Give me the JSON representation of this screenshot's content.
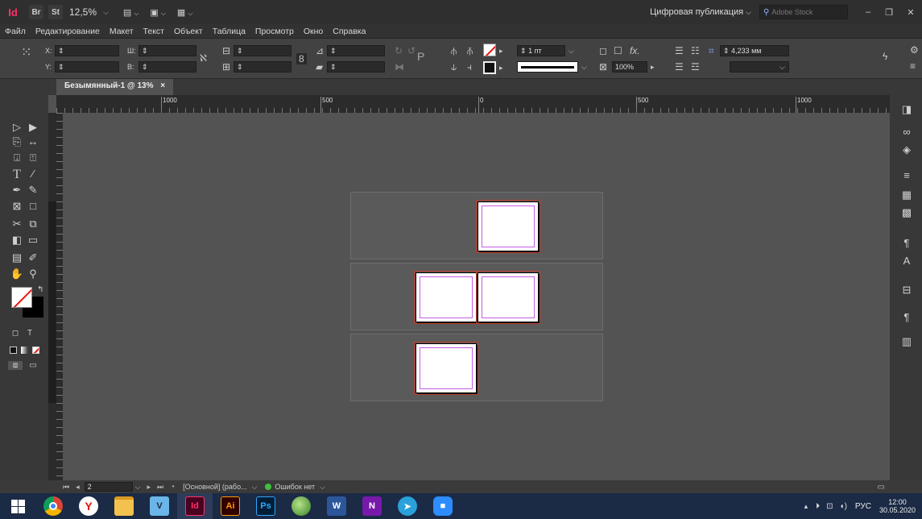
{
  "app": {
    "logo": "Id",
    "bridge": "Br",
    "stock": "St",
    "zoom": "12,5%",
    "workspace": "Цифровая публикация",
    "search_placeholder": "Adobe Stock",
    "minimize": "–",
    "restore": "❐",
    "close": "✕"
  },
  "menu": [
    "Файл",
    "Редактирование",
    "Макет",
    "Текст",
    "Объект",
    "Таблица",
    "Просмотр",
    "Окно",
    "Справка"
  ],
  "control": {
    "x_label": "X:",
    "y_label": "Y:",
    "w_label": "Ш:",
    "h_label": "В:",
    "stroke_weight": "1 пт",
    "opacity": "100%",
    "gap": "4,233 мм"
  },
  "document": {
    "tab_title": "Безымянный-1 @ 13%",
    "tab_close": "×"
  },
  "ruler": {
    "labels": [
      {
        "text": "1000"
      },
      {
        "text": "500"
      },
      {
        "text": "0"
      },
      {
        "text": "500"
      },
      {
        "text": "1000"
      }
    ],
    "v_labels": [
      "0",
      "0",
      "0"
    ]
  },
  "status": {
    "page_field": "2",
    "master": "[Основной] (рабо...",
    "preflight": "Ошибок нет"
  },
  "taskbar": {
    "lang": "РУС",
    "time": "12:00",
    "date": "30.05.2020",
    "apps": [
      {
        "name": "windows",
        "label": "",
        "color": "#1b2a45"
      },
      {
        "name": "chrome",
        "label": "",
        "color": "#e0a526"
      },
      {
        "name": "yandex",
        "label": "Y",
        "color": "#e8e8e8"
      },
      {
        "name": "explorer",
        "label": "",
        "color": "#f2c14e"
      },
      {
        "name": "visual-studio",
        "label": "V",
        "color": "#6bb5e8"
      },
      {
        "name": "indesign",
        "label": "Id",
        "color": "#49021f"
      },
      {
        "name": "illustrator",
        "label": "Ai",
        "color": "#330000"
      },
      {
        "name": "photoshop",
        "label": "Ps",
        "color": "#001e36"
      },
      {
        "name": "maps",
        "label": "",
        "color": "#6aa84f"
      },
      {
        "name": "word",
        "label": "W",
        "color": "#2b579a"
      },
      {
        "name": "onenote",
        "label": "N",
        "color": "#7719aa"
      },
      {
        "name": "telegram",
        "label": "",
        "color": "#2aa1da"
      },
      {
        "name": "zoom",
        "label": "",
        "color": "#2d8cff"
      }
    ]
  },
  "colors": {
    "id_brand": "#ff3366",
    "bleed": "#c0392b",
    "margin": "#c55ce6",
    "preflight_ok": "#3fbf3f"
  }
}
